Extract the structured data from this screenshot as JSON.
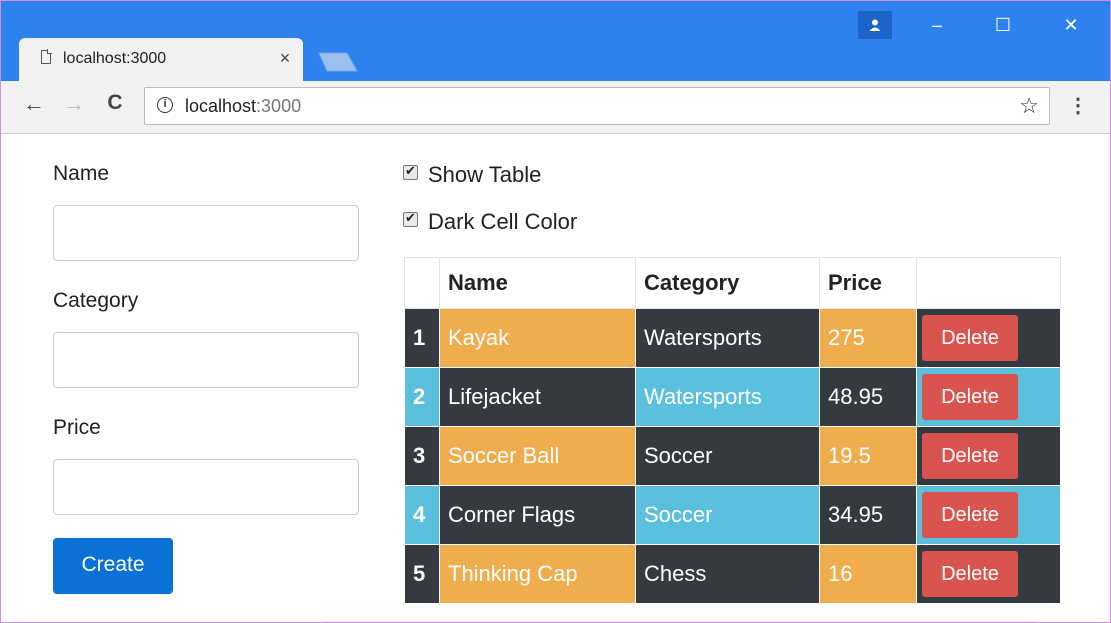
{
  "browser": {
    "tab_title": "localhost:3000",
    "tab_close": "×",
    "url_host": "localhost",
    "url_port": ":3000",
    "window_controls": {
      "minimize": "–",
      "maximize": "☐",
      "close": "✕"
    },
    "nav": {
      "back": "←",
      "forward": "→",
      "reload": "C"
    },
    "menu": "⋮",
    "bookmark": "☆",
    "profile": "👤",
    "info": "i"
  },
  "form": {
    "fields": [
      {
        "label": "Name",
        "value": ""
      },
      {
        "label": "Category",
        "value": ""
      },
      {
        "label": "Price",
        "value": ""
      }
    ],
    "create_label": "Create"
  },
  "options": {
    "show_table": {
      "label": "Show Table",
      "checked": true
    },
    "dark_cell": {
      "label": "Dark Cell Color",
      "checked": true
    }
  },
  "table": {
    "headers": [
      "",
      "Name",
      "Category",
      "Price",
      ""
    ],
    "delete_label": "Delete",
    "rows": [
      {
        "index": "1",
        "name": "Kayak",
        "category": "Watersports",
        "price": "275"
      },
      {
        "index": "2",
        "name": "Lifejacket",
        "category": "Watersports",
        "price": "48.95"
      },
      {
        "index": "3",
        "name": "Soccer Ball",
        "category": "Soccer",
        "price": "19.5"
      },
      {
        "index": "4",
        "name": "Corner Flags",
        "category": "Soccer",
        "price": "34.95"
      },
      {
        "index": "5",
        "name": "Thinking Cap",
        "category": "Chess",
        "price": "16"
      }
    ]
  },
  "colors": {
    "dark": "#343a40",
    "orange": "#f0ad4e",
    "cyan": "#5bc0de",
    "danger": "#d9534f",
    "primary": "#0a72d6",
    "chrome_blue": "#2e82f0"
  }
}
